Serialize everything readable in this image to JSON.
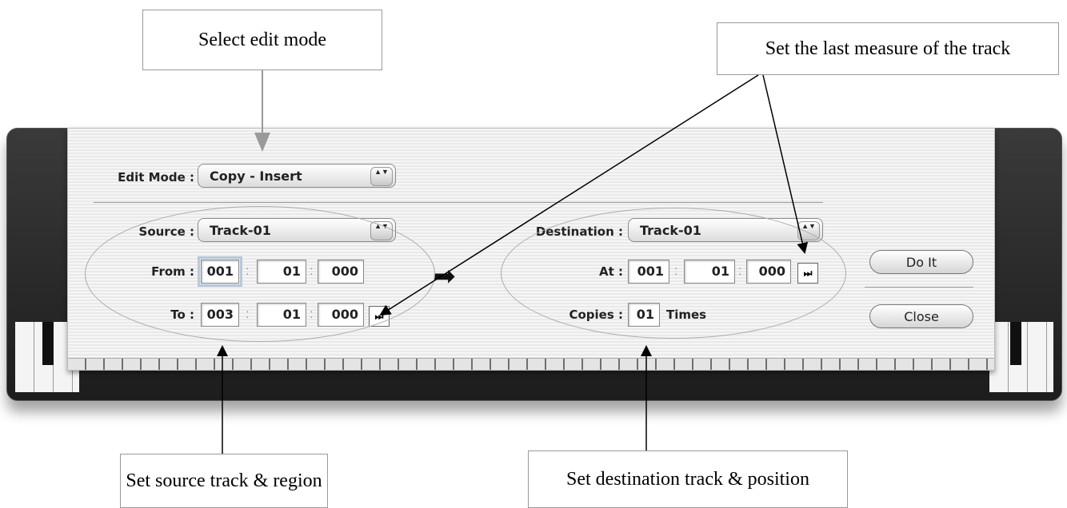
{
  "callouts": {
    "edit_mode": "Select edit mode",
    "last_measure": "Set the last measure of the track",
    "source": "Set source track & region",
    "destination": "Set destination track & position"
  },
  "dialog": {
    "edit_mode": {
      "label": "Edit Mode :",
      "value": "Copy - Insert"
    },
    "source": {
      "label": "Source :",
      "track": "Track-01",
      "from": {
        "label": "From :",
        "measure": "001",
        "beat": "01",
        "tick": "000"
      },
      "to": {
        "label": "To :",
        "measure": "003",
        "beat": "01",
        "tick": "000"
      }
    },
    "destination": {
      "label": "Destination :",
      "track": "Track-01",
      "at": {
        "label": "At :",
        "measure": "001",
        "beat": "01",
        "tick": "000"
      },
      "copies": {
        "label": "Copies :",
        "value": "01",
        "unit": "Times"
      }
    },
    "separator": ":",
    "end_glyph": "⏭",
    "stepper_glyph": "▲▼",
    "direction_arrow": "➡",
    "buttons": {
      "do_it": "Do It",
      "close": "Close"
    }
  },
  "icons": {
    "popup_stepper": "up-down-stepper-icon",
    "end_button": "skip-to-end-icon",
    "direction": "right-arrow-icon"
  },
  "colors": {
    "callout_arrow_gray": "#9a9a9a",
    "frame_dark": "#2a2a2a"
  }
}
